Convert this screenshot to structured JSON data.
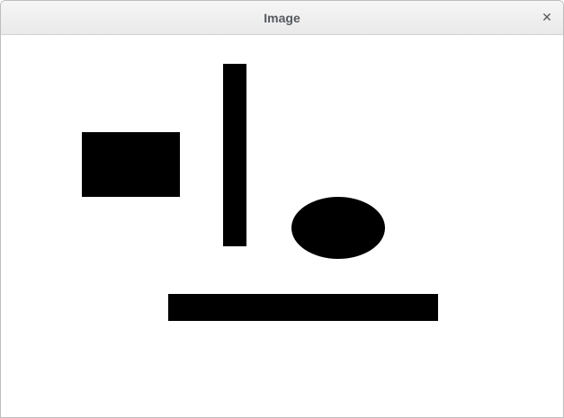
{
  "window": {
    "title": "Image",
    "close_glyph": "✕",
    "close_icon": "close-icon"
  },
  "canvas": {
    "background": "#ffffff",
    "shape_color": "#000000",
    "shapes": [
      {
        "kind": "rectangle"
      },
      {
        "kind": "rectangle"
      },
      {
        "kind": "ellipse"
      },
      {
        "kind": "rectangle"
      }
    ]
  }
}
